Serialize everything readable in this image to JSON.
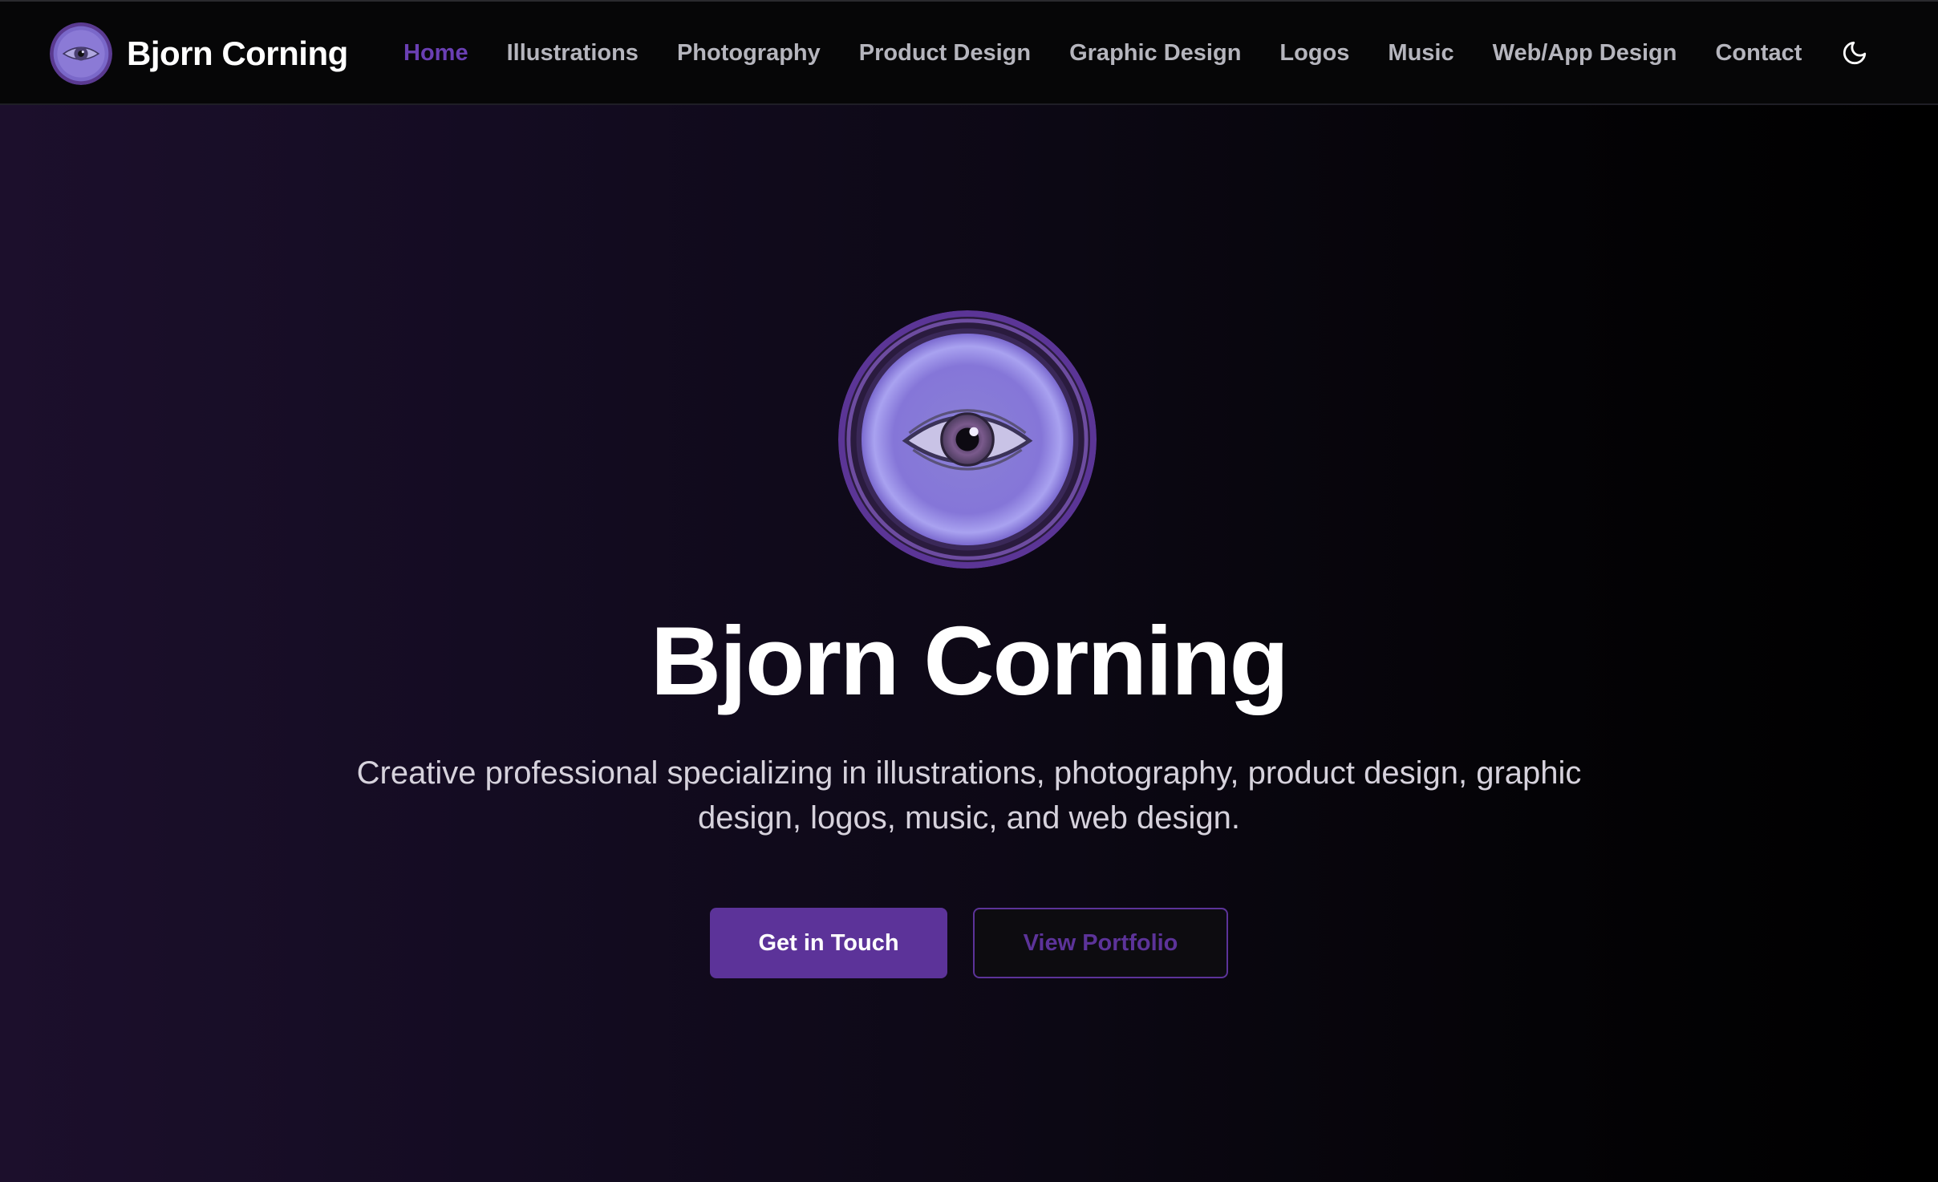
{
  "brand": {
    "name": "Bjorn Corning",
    "logo_icon": "eye-icon"
  },
  "nav": {
    "items": [
      {
        "label": "Home",
        "active": true
      },
      {
        "label": "Illustrations",
        "active": false
      },
      {
        "label": "Photography",
        "active": false
      },
      {
        "label": "Product Design",
        "active": false
      },
      {
        "label": "Graphic Design",
        "active": false
      },
      {
        "label": "Logos",
        "active": false
      },
      {
        "label": "Music",
        "active": false
      },
      {
        "label": "Web/App Design",
        "active": false
      },
      {
        "label": "Contact",
        "active": false
      }
    ],
    "theme_toggle_icon": "moon-icon"
  },
  "hero": {
    "avatar_icon": "eye-icon",
    "title": "Bjorn Corning",
    "subtitle": "Creative professional specializing in illustrations, photography, product design, graphic design, logos, music, and web design.",
    "primary_button": "Get in Touch",
    "secondary_button": "View Portfolio"
  },
  "colors": {
    "accent": "#5c3399",
    "nav_active": "#6a3fb3",
    "nav_text": "#b5b5bd",
    "background": "#000000"
  }
}
